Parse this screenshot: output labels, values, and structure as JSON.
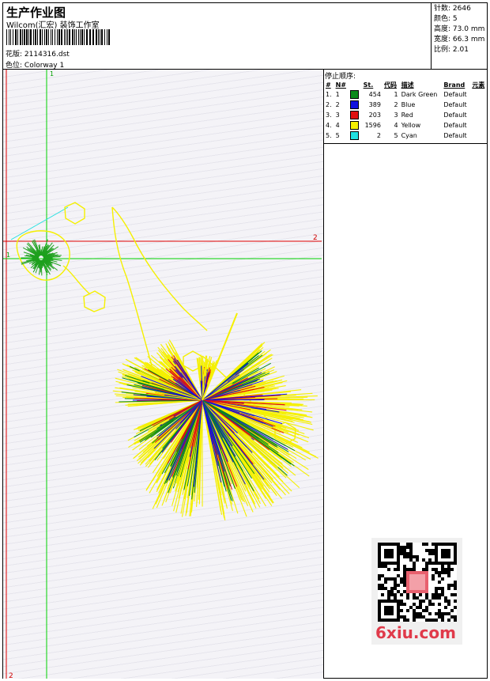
{
  "header": {
    "title": "生产作业图",
    "company": "Wilcom(汇宏) 装饰工作室",
    "design_label": "花版:",
    "design_value": "2114316.dst",
    "colorway_label": "色位:",
    "colorway_value": "Colorway 1"
  },
  "specs": [
    {
      "label": "针数:",
      "value": "2646"
    },
    {
      "label": "颜色:",
      "value": "5"
    },
    {
      "label": "高度:",
      "value": "73.0 mm"
    },
    {
      "label": "宽度:",
      "value": "66.3 mm"
    },
    {
      "label": "比例:",
      "value": "2.01"
    }
  ],
  "stop_sequence": {
    "title": "停止顺序:",
    "columns": [
      "#",
      "N#",
      "St.",
      "代码",
      "描述",
      "Brand",
      "元素"
    ],
    "rows": [
      {
        "idx": "1.",
        "n": "1",
        "color": "#0a8a1a",
        "st": "454",
        "code": "1",
        "desc": "Dark Green",
        "brand": "Default"
      },
      {
        "idx": "2.",
        "n": "2",
        "color": "#1010e0",
        "st": "389",
        "code": "2",
        "desc": "Blue",
        "brand": "Default"
      },
      {
        "idx": "3.",
        "n": "3",
        "color": "#e01010",
        "st": "203",
        "code": "3",
        "desc": "Red",
        "brand": "Default"
      },
      {
        "idx": "4.",
        "n": "4",
        "color": "#f5f000",
        "st": "1596",
        "code": "4",
        "desc": "Yellow",
        "brand": "Default"
      },
      {
        "idx": "5.",
        "n": "5",
        "color": "#20e0e0",
        "st": "2",
        "code": "5",
        "desc": "Cyan",
        "brand": "Default"
      }
    ]
  },
  "guides": {
    "v1_label": "1",
    "h1_label": "1",
    "h2_label": "2",
    "v2_label": "2"
  },
  "watermark": {
    "text": "6xiu.com"
  }
}
